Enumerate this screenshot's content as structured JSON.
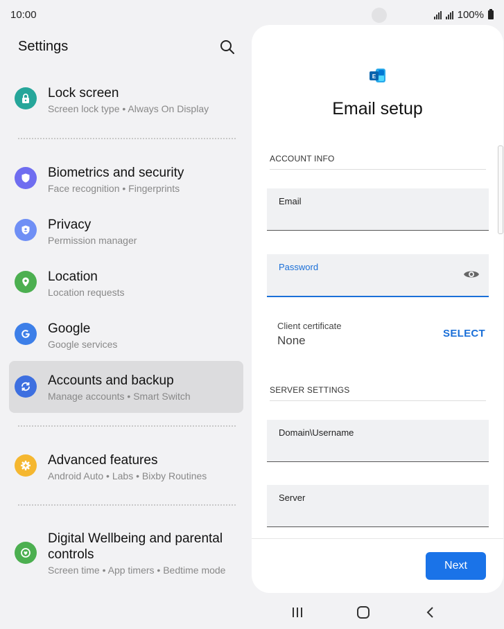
{
  "status": {
    "time": "10:00",
    "battery": "100%"
  },
  "settings": {
    "title": "Settings",
    "items": [
      {
        "title": "Lock screen",
        "subtitle": "Screen lock type  •  Always On Display",
        "icon": "lock-icon",
        "color": "#26a69a"
      },
      {
        "title": "Biometrics and security",
        "subtitle": "Face recognition  •  Fingerprints",
        "icon": "shield-icon",
        "color": "#6f6df0"
      },
      {
        "title": "Privacy",
        "subtitle": "Permission manager",
        "icon": "privacy-shield-icon",
        "color": "#6f8ff5"
      },
      {
        "title": "Location",
        "subtitle": "Location requests",
        "icon": "location-pin-icon",
        "color": "#4caf50"
      },
      {
        "title": "Google",
        "subtitle": "Google services",
        "icon": "google-g-icon",
        "color": "#3d7fe8"
      },
      {
        "title": "Accounts and backup",
        "subtitle": "Manage accounts  •  Smart Switch",
        "icon": "sync-icon",
        "color": "#3d6fe0"
      },
      {
        "title": "Advanced features",
        "subtitle": "Android Auto  •  Labs  •  Bixby Routines",
        "icon": "gear-plus-icon",
        "color": "#f5b730"
      },
      {
        "title": "Digital Wellbeing and parental",
        "title2": "controls",
        "subtitle": "Screen time  •  App timers  •  Bedtime mode",
        "icon": "wellbeing-icon",
        "color": "#4caf50"
      }
    ]
  },
  "email_setup": {
    "heading": "Email setup",
    "account_info": "ACCOUNT INFO",
    "email_label": "Email",
    "password_label": "Password",
    "client_certificate_label": "Client certificate",
    "client_certificate_value": "None",
    "select_label": "SELECT",
    "server_settings": "SERVER SETTINGS",
    "domain_label": "Domain\\Username",
    "server_label": "Server",
    "next_label": "Next"
  }
}
